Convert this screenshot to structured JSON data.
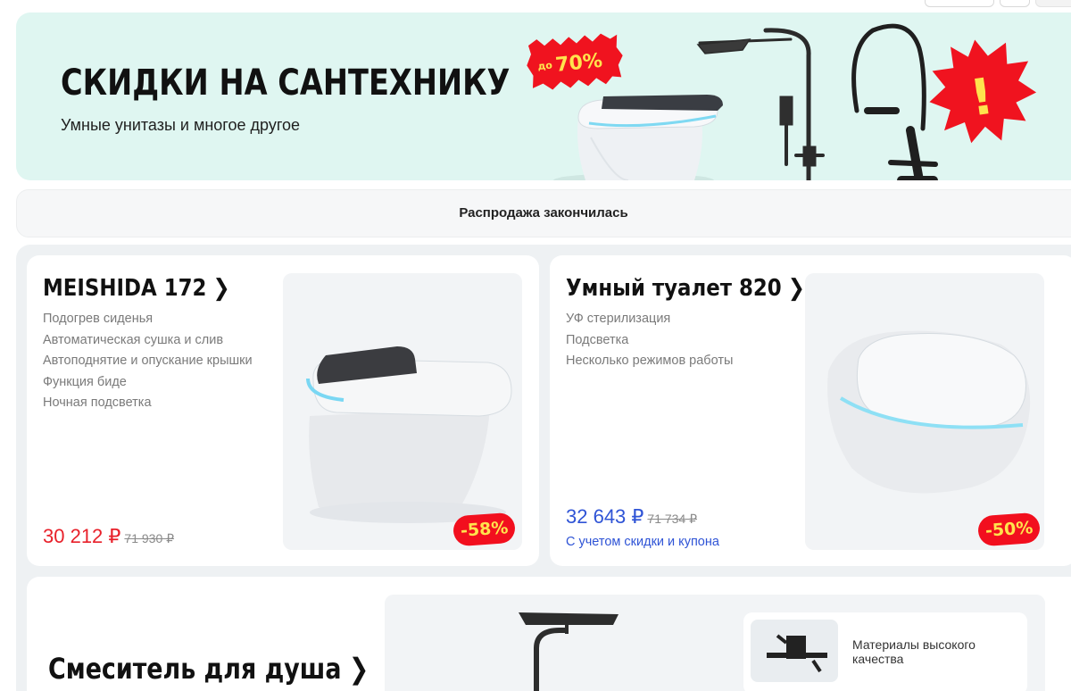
{
  "banner": {
    "title": "СКИДКИ НА САНТЕХНИКУ",
    "subtitle": "Умные унитазы и многое другое",
    "badge_prefix": "до",
    "badge_value": "70%",
    "burst_text": "!"
  },
  "sale_status": "Распродажа закончилась",
  "products": [
    {
      "title": "MEISHIDA 172",
      "features": [
        "Подогрев сиденья",
        "Автоматическая сушка и слив",
        "Автоподнятие и опускание крышки",
        "Функция биде",
        "Ночная подсветка"
      ],
      "price": "30 212 ₽",
      "old_price": "71 930 ₽",
      "discount": "-58%"
    },
    {
      "title": "Умный туалет 820",
      "features": [
        "УФ стерилизация",
        "Подсветка",
        "Несколько режимов работы"
      ],
      "price": "32 643 ₽",
      "old_price": "71 734 ₽",
      "price_note": "С учетом скидки и купона",
      "discount": "-50%"
    }
  ],
  "shower": {
    "title": "Смеситель для душа",
    "feature_text": "Материалы высокого качества"
  },
  "icons": {
    "chevron": "chevron-right-icon"
  },
  "colors": {
    "banner_bg": "#dff6f1",
    "price_red": "#e8202a",
    "price_blue": "#2f54d6",
    "discount_bg": "#f20f1e",
    "discount_text": "#ffe34d"
  }
}
